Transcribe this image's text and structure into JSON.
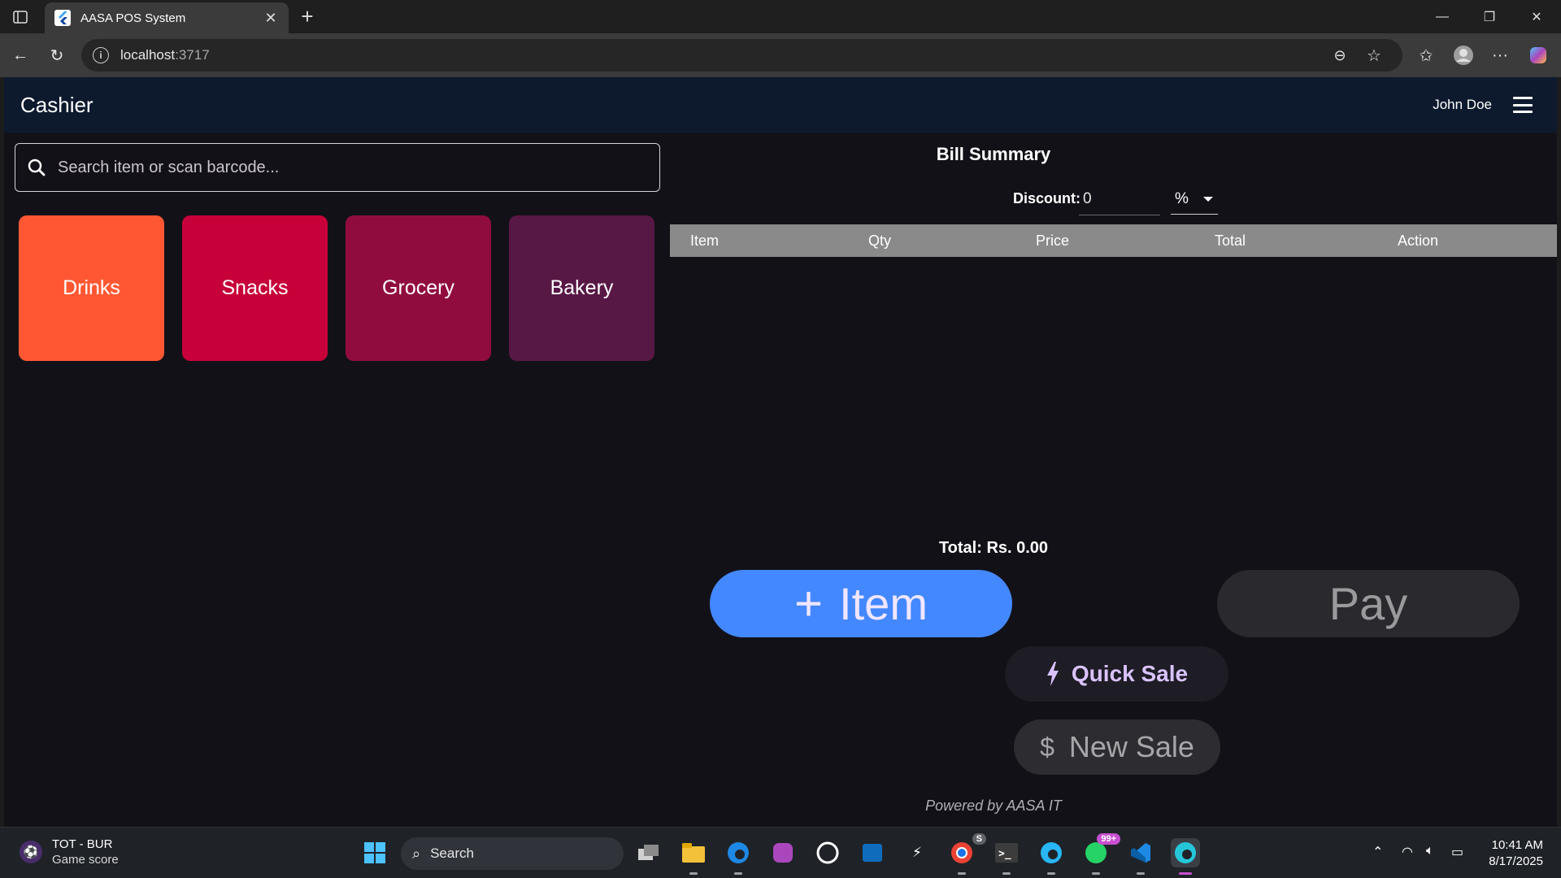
{
  "browser": {
    "tab_title": "AASA POS System",
    "url_host": "localhost",
    "url_port": ":3717"
  },
  "app": {
    "title": "Cashier",
    "user": "John Doe"
  },
  "search": {
    "placeholder": "Search item or scan barcode..."
  },
  "categories": [
    {
      "label": "Drinks",
      "color": "#ff5733"
    },
    {
      "label": "Snacks",
      "color": "#c70039"
    },
    {
      "label": "Grocery",
      "color": "#900c3f"
    },
    {
      "label": "Bakery",
      "color": "#581845"
    }
  ],
  "bill": {
    "title": "Bill Summary",
    "discount_label": "Discount:",
    "discount_value": "0",
    "discount_type": "%",
    "columns": [
      "Item",
      "Qty",
      "Price",
      "Total",
      "Action"
    ],
    "rows": [],
    "total_text": "Total: Rs. 0.00"
  },
  "actions": {
    "add_item_label": "Item",
    "pay_label": "Pay",
    "quick_sale_label": "Quick Sale",
    "new_sale_label": "New Sale"
  },
  "footer": {
    "powered_by": "Powered by AASA IT"
  },
  "taskbar": {
    "weather_line1": "TOT - BUR",
    "weather_line2": "Game score",
    "search_label": "Search",
    "whatsapp_badge": "99+",
    "chrome_badge": "S",
    "time": "10:41 AM",
    "date": "8/17/2025"
  }
}
